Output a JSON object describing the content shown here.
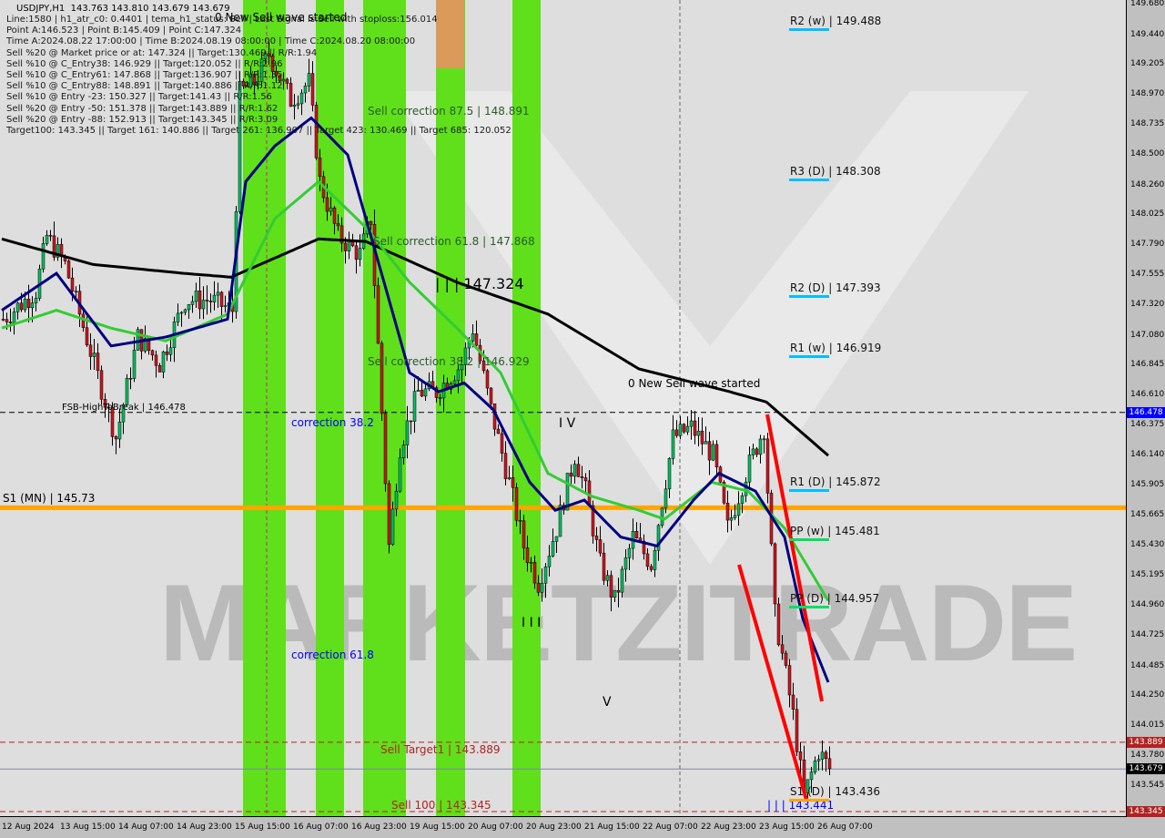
{
  "header": {
    "symbol": "USDJPY,H1",
    "ohlc": "143.763 143.810 143.679 143.679"
  },
  "info_lines": [
    "Line:1580 | h1_atr_c0: 0.4401 | tema_h1_status: Sell | Last Signal is:Sell with stoploss:156.014",
    "Point A:146.523 | Point B:145.409 | Point C:147.324",
    "Time A:2024.08.22 17:00:00 | Time B:2024.08.19 08:00:00 | Time C:2024.08.20 08:00:00",
    "Sell %20 @ Market price or at: 147.324 || Target:130.469 || R/R:1.94",
    "Sell %10 @ C_Entry38: 146.929 || Target:120.052 || R/R:2.96",
    "Sell %10 @ C_Entry61: 147.868 || Target:136.907 || R/R:1.35",
    "Sell %10 @ C_Entry88: 148.891 || Target:140.886 || R/R:1.12",
    "Sell %10 @ Entry -23: 150.327 || Target:141.43 || R/R:1.56",
    "Sell %20 @ Entry -50: 151.378 || Target:143.889 || R/R:1.62",
    "Sell %20 @ Entry -88: 152.913 || Target:143.345 || R/R:3.09",
    "Target100: 143.345 || Target 161: 140.886 || Target 261: 136.907 || Target 423: 130.469 || Target 685: 120.052"
  ],
  "watermark": "MARKETZITRADE",
  "chart_data": {
    "type": "candlestick",
    "symbol": "USDJPY",
    "timeframe": "H1",
    "ylim": [
      143.31,
      149.72
    ],
    "y_ticks": [
      149.68,
      149.44,
      149.205,
      148.97,
      148.735,
      148.5,
      148.26,
      148.025,
      147.79,
      147.555,
      147.32,
      147.08,
      146.845,
      146.61,
      146.375,
      146.14,
      145.905,
      145.665,
      145.43,
      145.195,
      144.96,
      144.725,
      144.485,
      144.25,
      144.015,
      143.78,
      143.545
    ],
    "x_ticks": [
      "12 Aug 2024",
      "13 Aug 15:00",
      "14 Aug 07:00",
      "14 Aug 23:00",
      "15 Aug 15:00",
      "16 Aug 07:00",
      "16 Aug 23:00",
      "19 Aug 15:00",
      "20 Aug 07:00",
      "20 Aug 23:00",
      "21 Aug 15:00",
      "22 Aug 07:00",
      "22 Aug 23:00",
      "23 Aug 15:00",
      "26 Aug 07:00"
    ],
    "price_path_bars": [
      [
        0,
        147.21
      ],
      [
        9,
        147.43
      ],
      [
        12,
        147.86
      ],
      [
        17,
        147.64
      ],
      [
        25,
        146.86
      ],
      [
        31,
        146.28
      ],
      [
        37,
        147.07
      ],
      [
        43,
        146.86
      ],
      [
        50,
        147.36
      ],
      [
        57,
        147.36
      ],
      [
        63,
        147.28
      ],
      [
        65,
        148.99
      ],
      [
        69,
        149.07
      ],
      [
        73,
        149.29
      ],
      [
        79,
        148.93
      ],
      [
        84,
        149.07
      ],
      [
        87,
        148.29
      ],
      [
        92,
        147.86
      ],
      [
        98,
        147.72
      ],
      [
        101,
        148.0
      ],
      [
        103,
        147.0
      ],
      [
        106,
        145.43
      ],
      [
        109,
        146.21
      ],
      [
        114,
        146.64
      ],
      [
        119,
        146.64
      ],
      [
        126,
        146.86
      ],
      [
        129,
        147.14
      ],
      [
        134,
        146.5
      ],
      [
        139,
        145.93
      ],
      [
        143,
        145.43
      ],
      [
        147,
        145.14
      ],
      [
        152,
        145.57
      ],
      [
        157,
        146.14
      ],
      [
        160,
        145.86
      ],
      [
        164,
        145.29
      ],
      [
        168,
        145.0
      ],
      [
        173,
        145.5
      ],
      [
        178,
        145.29
      ],
      [
        184,
        146.28
      ],
      [
        189,
        146.36
      ],
      [
        195,
        146.14
      ],
      [
        199,
        145.57
      ],
      [
        204,
        146.0
      ],
      [
        209,
        146.36
      ],
      [
        212,
        144.89
      ],
      [
        217,
        144.1
      ],
      [
        220,
        143.46
      ],
      [
        224,
        143.82
      ],
      [
        227,
        143.68
      ]
    ],
    "ma_black": [
      [
        0,
        147.84
      ],
      [
        25,
        147.64
      ],
      [
        50,
        147.57
      ],
      [
        63,
        147.54
      ],
      [
        87,
        147.84
      ],
      [
        100,
        147.82
      ],
      [
        125,
        147.5
      ],
      [
        150,
        147.25
      ],
      [
        175,
        146.82
      ],
      [
        200,
        146.64
      ],
      [
        210,
        146.56
      ],
      [
        227,
        146.14
      ]
    ],
    "ma_green": [
      [
        0,
        147.14
      ],
      [
        15,
        147.28
      ],
      [
        30,
        147.14
      ],
      [
        45,
        147.04
      ],
      [
        62,
        147.25
      ],
      [
        75,
        148.0
      ],
      [
        87,
        148.29
      ],
      [
        100,
        147.93
      ],
      [
        112,
        147.5
      ],
      [
        125,
        147.14
      ],
      [
        137,
        146.79
      ],
      [
        150,
        146.0
      ],
      [
        162,
        145.82
      ],
      [
        175,
        145.71
      ],
      [
        182,
        145.64
      ],
      [
        195,
        145.93
      ],
      [
        205,
        145.86
      ],
      [
        215,
        145.57
      ],
      [
        227,
        145.0
      ]
    ],
    "ma_blue": [
      [
        0,
        147.28
      ],
      [
        15,
        147.57
      ],
      [
        30,
        147.0
      ],
      [
        45,
        147.07
      ],
      [
        62,
        147.21
      ],
      [
        67,
        148.29
      ],
      [
        75,
        148.57
      ],
      [
        85,
        148.79
      ],
      [
        95,
        148.5
      ],
      [
        105,
        147.5
      ],
      [
        112,
        146.79
      ],
      [
        120,
        146.64
      ],
      [
        127,
        146.71
      ],
      [
        135,
        146.5
      ],
      [
        145,
        145.93
      ],
      [
        152,
        145.71
      ],
      [
        160,
        145.79
      ],
      [
        170,
        145.5
      ],
      [
        180,
        145.43
      ],
      [
        190,
        145.79
      ],
      [
        197,
        146.0
      ],
      [
        207,
        145.86
      ],
      [
        215,
        145.5
      ],
      [
        220,
        144.86
      ],
      [
        227,
        144.36
      ]
    ],
    "levels": [
      {
        "label": "FSB-HighToBreak | 146.478",
        "price": 146.478,
        "color": "#000000",
        "style": "dashed"
      },
      {
        "label": "S1 (MN) | 145.73",
        "price": 145.73,
        "color": "#ffa500",
        "style": "solid"
      },
      {
        "label": "Sell Target1 | 143.889",
        "price": 143.889,
        "color": "#b22222",
        "style": "dashed"
      },
      {
        "label": "Sell 100 | 143.345",
        "price": 143.345,
        "color": "#b22222",
        "style": "dashed"
      }
    ],
    "current_price": 143.679,
    "price_tags": [
      {
        "value": "146.478",
        "color": "#0000ff"
      },
      {
        "value": "143.889",
        "color": "#b22222"
      },
      {
        "value": "143.679",
        "color": "#000000"
      },
      {
        "value": "143.345",
        "color": "#b22222"
      }
    ],
    "pivots": [
      {
        "label": "R2 (w) | 149.488",
        "price": 149.488,
        "color": "#00bfff"
      },
      {
        "label": "R3 (D) | 148.308",
        "price": 148.308,
        "color": "#00bfff"
      },
      {
        "label": "R2 (D) | 147.393",
        "price": 147.393,
        "color": "#00bfff"
      },
      {
        "label": "R1 (w) | 146.919",
        "price": 146.919,
        "color": "#00bfff"
      },
      {
        "label": "R1 (D) | 145.872",
        "price": 145.872,
        "color": "#00bfff"
      },
      {
        "label": "PP (w) | 145.481",
        "price": 145.481,
        "color": "#00e060"
      },
      {
        "label": "PP (D) | 144.957",
        "price": 144.957,
        "color": "#00e060"
      },
      {
        "label": "S1 (D) | 143.436",
        "price": 143.436,
        "color": "#ffa500"
      }
    ],
    "annotations": {
      "new_sell_wave": "0 New Sell wave started",
      "sell_corr_875": "Sell correction 87.5 | 148.891",
      "sell_corr_618": "Sell correction 61.8 | 147.868",
      "sell_corr_382": "Sell correction 38.2 | 146.929",
      "point_c": "| | | 147.324",
      "corr_382": "correction 38.2",
      "corr_618": "correction 61.8",
      "wave_iv": "I V",
      "wave_v": "V",
      "wave_iii": "I I I",
      "bottom_target": "| | | 143.441"
    },
    "colors": {
      "bull": "#00c060",
      "bear": "#d0141e",
      "band_green": "#5fe01a",
      "band_orange": "#d99a5a",
      "ma_black": "#000000",
      "ma_green": "#33cc33",
      "ma_blue": "#000080",
      "trend": "#ff0000"
    }
  }
}
